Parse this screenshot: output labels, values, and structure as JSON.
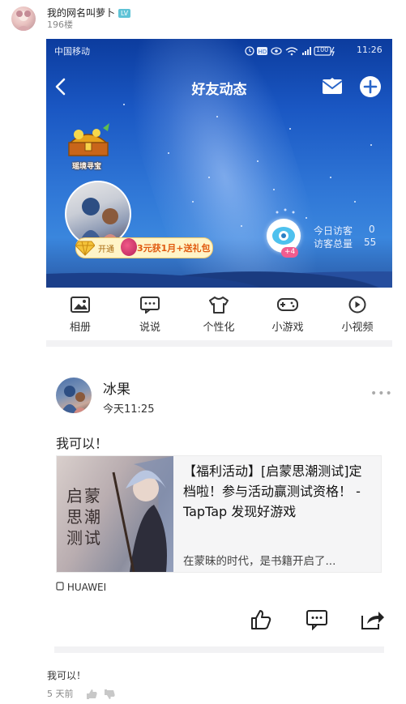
{
  "forum": {
    "username": "我的网名叫萝卜",
    "level": "LV",
    "floor": "196楼",
    "reply_text": "我可以！",
    "reply_age": "5 天前"
  },
  "status": {
    "carrier": "中国移动",
    "time": "11:26",
    "battery": "100"
  },
  "nav": {
    "title": "好友动态"
  },
  "hero": {
    "treasure_label": "瑶境寻宝",
    "open_label": "开通",
    "promo": "3元获1月+送礼包",
    "badge": "+4",
    "today_label": "今日访客",
    "today_value": "0",
    "total_label": "访客总量",
    "total_value": "55"
  },
  "icons": [
    {
      "label": "相册",
      "icon": "photo-icon"
    },
    {
      "label": "说说",
      "icon": "chat-icon"
    },
    {
      "label": "个性化",
      "icon": "shirt-icon"
    },
    {
      "label": "小游戏",
      "icon": "gamepad-icon"
    },
    {
      "label": "小视频",
      "icon": "play-icon"
    }
  ],
  "post": {
    "author": "冰果",
    "time": "今天11:25",
    "text": "我可以！",
    "device": "HUAWEI",
    "link_title": "【福利活动】[启蒙思潮测试]定档啦！参与活动赢测试资格！ - TapTap 发现好游戏",
    "link_desc": "在蒙昧的时代，是书籍开启了...",
    "thumb_text": "启蒙思潮测试"
  },
  "colors": {
    "sky_top": "#0c3c9e",
    "sky_mid": "#2f76d6",
    "promo_bg": "#fff4c8",
    "promo_text": "#e05a10"
  }
}
